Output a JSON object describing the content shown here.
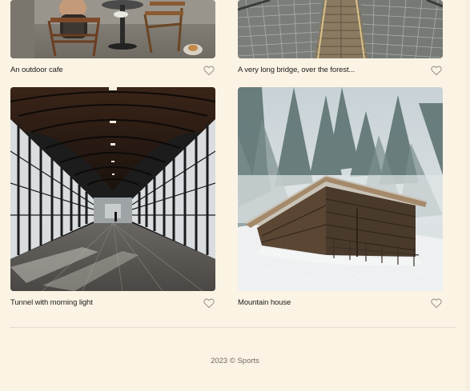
{
  "gallery": {
    "items": [
      {
        "caption": "An outdoor cafe",
        "image": "outdoor cafe chairs and table",
        "liked": false
      },
      {
        "caption": "A very long bridge, over the forest...",
        "image": "suspension bridge",
        "liked": false
      },
      {
        "caption": "Tunnel with morning light",
        "image": "glass arched tunnel corridor",
        "liked": false
      },
      {
        "caption": "Mountain house",
        "image": "wooden hut in snowy forest",
        "liked": false
      }
    ]
  },
  "footer": {
    "text": "2023 © Sports"
  },
  "colors": {
    "background": "#fbf3e4",
    "heart_outline": "#9a958e",
    "divider": "#e6ddd0"
  }
}
